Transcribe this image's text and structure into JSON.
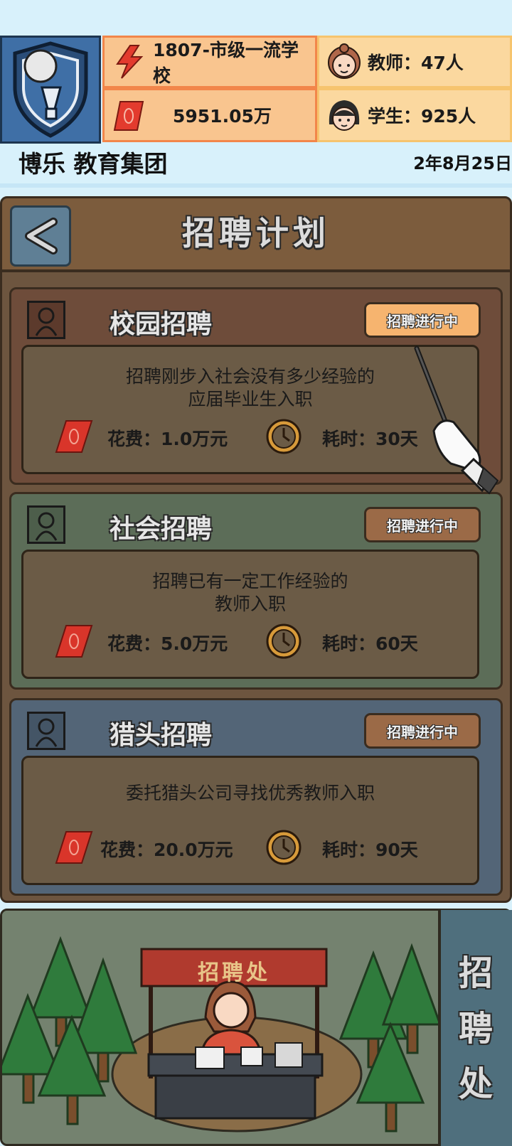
{
  "header": {
    "school_level": "1807-市级一流学校",
    "money": "5951.05万",
    "teachers": "教师：47人",
    "students": "学生：925人",
    "school_name": "博乐 教育集团",
    "date": "2年8月25日"
  },
  "page": {
    "title": "招聘计划"
  },
  "cards": [
    {
      "name": "校园招聘",
      "status": "招聘进行中",
      "desc_line1": "招聘刚步入社会没有多少经验的",
      "desc_line2": "应届毕业生入职",
      "cost": "花费：1.0万元",
      "time": "耗时：30天"
    },
    {
      "name": "社会招聘",
      "status": "招聘进行中",
      "desc_line1": "招聘已有一定工作经验的",
      "desc_line2": "教师入职",
      "cost": "花费：5.0万元",
      "time": "耗时：60天"
    },
    {
      "name": "猎头招聘",
      "status": "招聘进行中",
      "desc_line1": "委托猎头公司寻找优秀教师入职",
      "desc_line2": "",
      "cost": "花费：20.0万元",
      "time": "耗时：90天"
    }
  ],
  "scene": {
    "booth_sign": "招聘处",
    "side_tab": "招聘处"
  },
  "colors": {
    "card1_bg": "#6e4c3a",
    "card2_bg": "#5c6d58",
    "card3_bg": "#536577",
    "accent_orange": "#f6b46f"
  },
  "icons": [
    "shield-torch-icon",
    "lightning-icon",
    "money-icon",
    "teacher-avatar-icon",
    "student-avatar-icon",
    "back-arrow-icon",
    "person-icon",
    "clock-icon",
    "pointer-hand-icon"
  ]
}
